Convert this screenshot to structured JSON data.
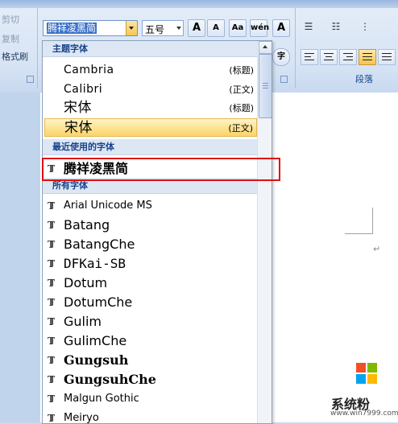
{
  "ribbon": {
    "clipboard": {
      "cut": "剪切",
      "copy": "复制",
      "format_painter": "格式刷"
    },
    "font": {
      "font_name": "腾祥凌黑简",
      "font_size": "五号",
      "grow_label": "A",
      "shrink_label": "A",
      "clear_format_label": "Aa",
      "phonetic_label": "wén",
      "border_char_label": "A",
      "enclose_char_label": "字"
    },
    "paragraph": {
      "group_label": "段落"
    }
  },
  "dropdown": {
    "theme_section": "主题字体",
    "theme_fonts": [
      {
        "name": "Cambria",
        "tag": "(标题)",
        "selected": false
      },
      {
        "name": "Calibri",
        "tag": "(正文)",
        "selected": false
      },
      {
        "name": "宋体",
        "tag": "(标题)",
        "selected": false
      },
      {
        "name": "宋体",
        "tag": "(正文)",
        "selected": true
      }
    ],
    "recent_section": "最近使用的字体",
    "recent_fonts": [
      "腾祥凌黑简"
    ],
    "all_section": "所有字体",
    "all_fonts": [
      "Arial Unicode MS",
      "Batang",
      "BatangChe",
      "DFKai-SB",
      "Dotum",
      "DotumChe",
      "Gulim",
      "GulimChe",
      "Gungsuh",
      "GungsuhChe",
      "Malgun Gothic",
      "Meiryo"
    ]
  },
  "document": {
    "paragraph_mark": "↵"
  },
  "watermark": {
    "text": "系统粉",
    "url": "www.win7999.com"
  },
  "colors": {
    "highlight": "#fde08b",
    "annotation": "#e01010",
    "header": "#dde7f4"
  }
}
